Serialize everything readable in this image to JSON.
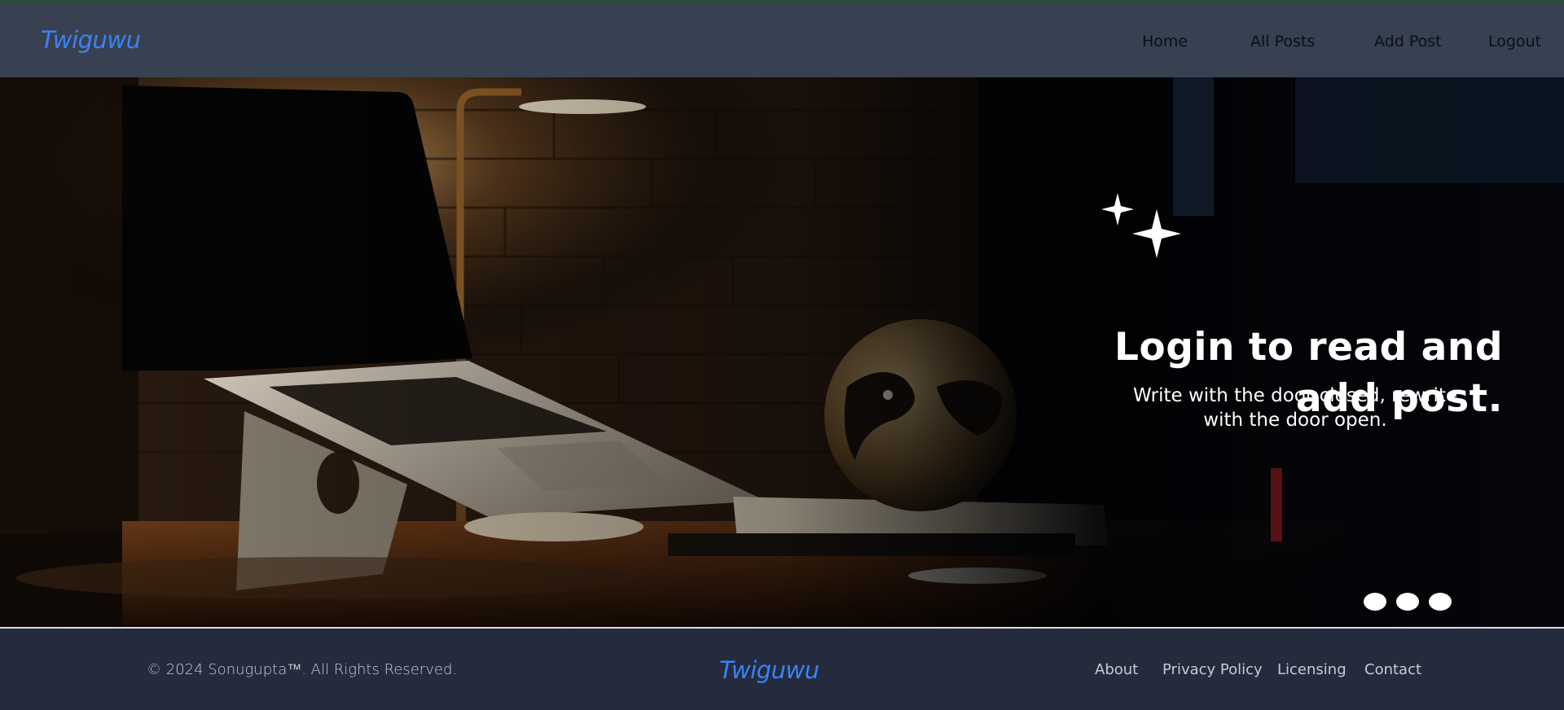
{
  "navbar": {
    "brand": "Twiguwu",
    "links": [
      "Home",
      "All Posts",
      "Add Post",
      "Logout"
    ]
  },
  "hero": {
    "title_line1": "Login to read and",
    "title_line2": "add post.",
    "subtitle_line1": "Write with the door closed, rewrite",
    "subtitle_line2": "with the door open.",
    "slide_indicators": 3,
    "image_description_icon": "laptop-desk-scene-image",
    "sparkle_icon": "sparkle-icon"
  },
  "footer": {
    "copyright": "© 2024 Sonugupta™. All Rights Reserved.",
    "brand": "Twiguwu",
    "links": [
      "About",
      "Privacy Policy",
      "Licensing",
      "Contact"
    ]
  },
  "colors": {
    "navbar_bg": "#374151",
    "footer_bg": "#242b3d",
    "brand_blue": "#3b82f6",
    "hero_text": "#ffffff"
  }
}
